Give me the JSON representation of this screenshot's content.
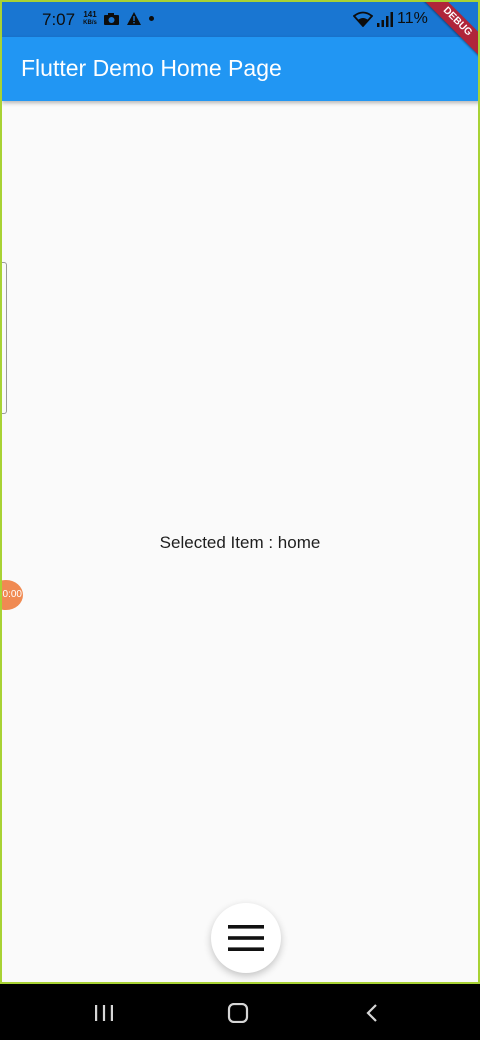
{
  "status_bar": {
    "time": "7:07",
    "net_speed_value": "141",
    "net_speed_unit": "KB/s",
    "battery_text": "11%",
    "icons": [
      "camera-icon",
      "warning-icon",
      "dot-icon",
      "wifi-icon",
      "signal-icon"
    ]
  },
  "app_bar": {
    "title": "Flutter Demo Home Page",
    "debug_banner": "DEBUG"
  },
  "main": {
    "selected_text": "Selected Item : home"
  },
  "overlay": {
    "timer_text": "0:00"
  },
  "fab": {
    "icon": "menu-icon"
  },
  "nav_bar": {
    "icons": [
      "recents-icon",
      "home-icon",
      "back-icon"
    ]
  },
  "colors": {
    "app_bar": "#2196f3",
    "status_bar": "#1976d2",
    "background": "#fafafa",
    "debug_banner": "#b0253a",
    "timer_bubble": "#f08a52"
  }
}
